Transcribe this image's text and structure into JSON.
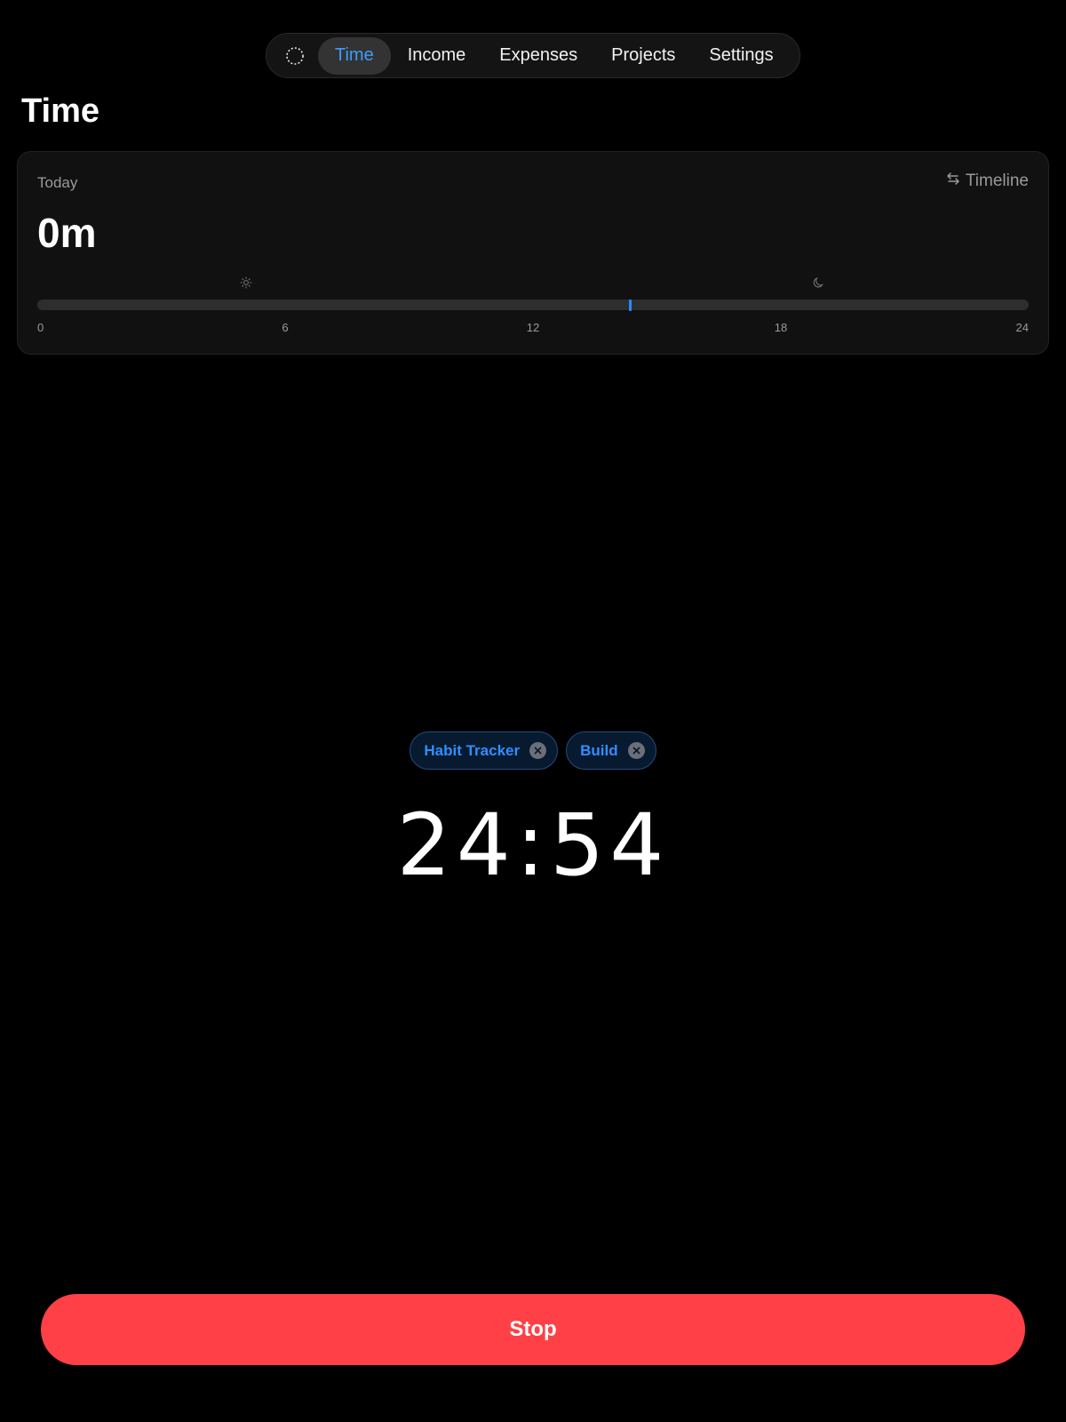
{
  "nav": {
    "logo_icon": "dashed-circle-icon",
    "tabs": [
      {
        "label": "Time",
        "active": true
      },
      {
        "label": "Income",
        "active": false
      },
      {
        "label": "Expenses",
        "active": false
      },
      {
        "label": "Projects",
        "active": false
      },
      {
        "label": "Settings",
        "active": false
      }
    ]
  },
  "page_title": "Time",
  "today_card": {
    "label": "Today",
    "timeline_label": "Timeline",
    "total": "0m",
    "day_scale": {
      "ticks": [
        "0",
        "6",
        "12",
        "18",
        "24"
      ],
      "current_hour": 14.35,
      "day_icon": "sun-icon",
      "night_icon": "moon-icon"
    }
  },
  "active_tags": [
    {
      "label": "Habit Tracker"
    },
    {
      "label": "Build"
    }
  ],
  "timer": "24:54",
  "stop_label": "Stop",
  "colors": {
    "accent": "#3d9bff",
    "stop": "#ff4047",
    "background": "#000000"
  }
}
